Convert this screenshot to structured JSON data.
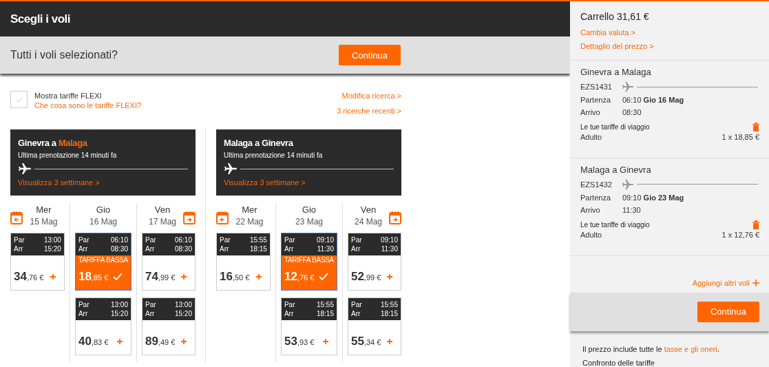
{
  "header": {
    "title": "Scegli i voli"
  },
  "confirm_bar": {
    "question": "Tutti i voli selezionati?",
    "button": "Continua"
  },
  "options": {
    "flexi": {
      "label": "Mostra tariffe FLEXI",
      "checked": false,
      "help_link": "Che cosa sono le tariffe FLEXI?"
    },
    "links": [
      "Modifica ricerca >",
      "3 ricerche recenti >"
    ]
  },
  "journeys": [
    {
      "title": "Ginevra a",
      "title_highlight": "Malaga",
      "last_booking": "Ultima prenotazione 14 minuti fa",
      "weeks_link": "Visualizza 3 settimane >",
      "days": [
        {
          "weekday": "Mer",
          "date": "15 Mag",
          "flights": [
            {
              "dep_label": "Par",
              "dep": "13:00",
              "arr_label": "Arr",
              "arr": "15:20",
              "price_main": "34",
              "price_cents": ",76 €",
              "selected": false
            }
          ]
        },
        {
          "weekday": "Gio",
          "date": "16 Mag",
          "flights": [
            {
              "dep_label": "Par",
              "dep": "06:10",
              "arr_label": "Arr",
              "arr": "08:30",
              "badge": "TARIFFA BASSA",
              "price_main": "18",
              "price_cents": ",85 €",
              "selected": true
            },
            {
              "dep_label": "Par",
              "dep": "13:00",
              "arr_label": "Arr",
              "arr": "15:20",
              "price_main": "40",
              "price_cents": ",83 €",
              "selected": false
            }
          ]
        },
        {
          "weekday": "Ven",
          "date": "17 Mag",
          "flights": [
            {
              "dep_label": "Par",
              "dep": "06:10",
              "arr_label": "Arr",
              "arr": "08:30",
              "price_main": "74",
              "price_cents": ",99 €",
              "selected": false
            },
            {
              "dep_label": "Par",
              "dep": "13:00",
              "arr_label": "Arr",
              "arr": "15:20",
              "price_main": "89",
              "price_cents": ",49 €",
              "selected": false
            }
          ]
        }
      ]
    },
    {
      "title": "Malaga a Ginevra",
      "last_booking": "Ultima prenotazione 14 minuti fa",
      "weeks_link": "Visualizza 3 settimane >",
      "days": [
        {
          "weekday": "Mer",
          "date": "22 Mag",
          "flights": [
            {
              "dep_label": "Par",
              "dep": "15:55",
              "arr_label": "Arr",
              "arr": "18:15",
              "price_main": "16",
              "price_cents": ",50 €",
              "selected": false
            }
          ]
        },
        {
          "weekday": "Gio",
          "date": "23 Mag",
          "flights": [
            {
              "dep_label": "Par",
              "dep": "09:10",
              "arr_label": "Arr",
              "arr": "11:30",
              "badge": "TARIFFA BASSA",
              "price_main": "12",
              "price_cents": ",76 €",
              "selected": true
            },
            {
              "dep_label": "Par",
              "dep": "15:55",
              "arr_label": "Arr",
              "arr": "18:15",
              "price_main": "53",
              "price_cents": ",93 €",
              "selected": false
            }
          ]
        },
        {
          "weekday": "Ven",
          "date": "24 Mag",
          "flights": [
            {
              "dep_label": "Par",
              "dep": "09:10",
              "arr_label": "Arr",
              "arr": "11:30",
              "price_main": "52",
              "price_cents": ",99 €",
              "selected": false
            },
            {
              "dep_label": "Par",
              "dep": "15:55",
              "arr_label": "Arr",
              "arr": "18:15",
              "price_main": "55",
              "price_cents": ",34 €",
              "selected": false
            }
          ]
        }
      ]
    }
  ],
  "cart": {
    "title": "Carrello 31,61 €",
    "links": [
      "Cambia valuta >",
      "Dettaglio del prezzo >"
    ],
    "trips": [
      {
        "title": "Ginevra a Malaga",
        "flight_number": "EZS1431",
        "departure_label": "Partenza",
        "departure": "06:10 **Gio 16 Mag**",
        "arrival_label": "Arrivo",
        "arrival": "08:30",
        "fares_label": "Le tue tariffe di viaggio",
        "passenger": "Adulto",
        "amount": "1 x 18,85 €"
      },
      {
        "title": "Malaga a Ginevra",
        "flight_number": "EZS1432",
        "departure_label": "Partenza",
        "departure": "09:10 **Gio 23 Mag**",
        "arrival_label": "Arrivo",
        "arrival": "11:30",
        "fares_label": "Le tue tariffe di viaggio",
        "passenger": "Adulto",
        "amount": "1 x 12,76 €"
      }
    ],
    "add_flights": "Aggiungi altri voli",
    "button": "Continua",
    "note": "Il prezzo include tutte le",
    "note_link": "tasse e gli oneri",
    "note_end": ".",
    "compare": "Confronto delle tariffe"
  }
}
